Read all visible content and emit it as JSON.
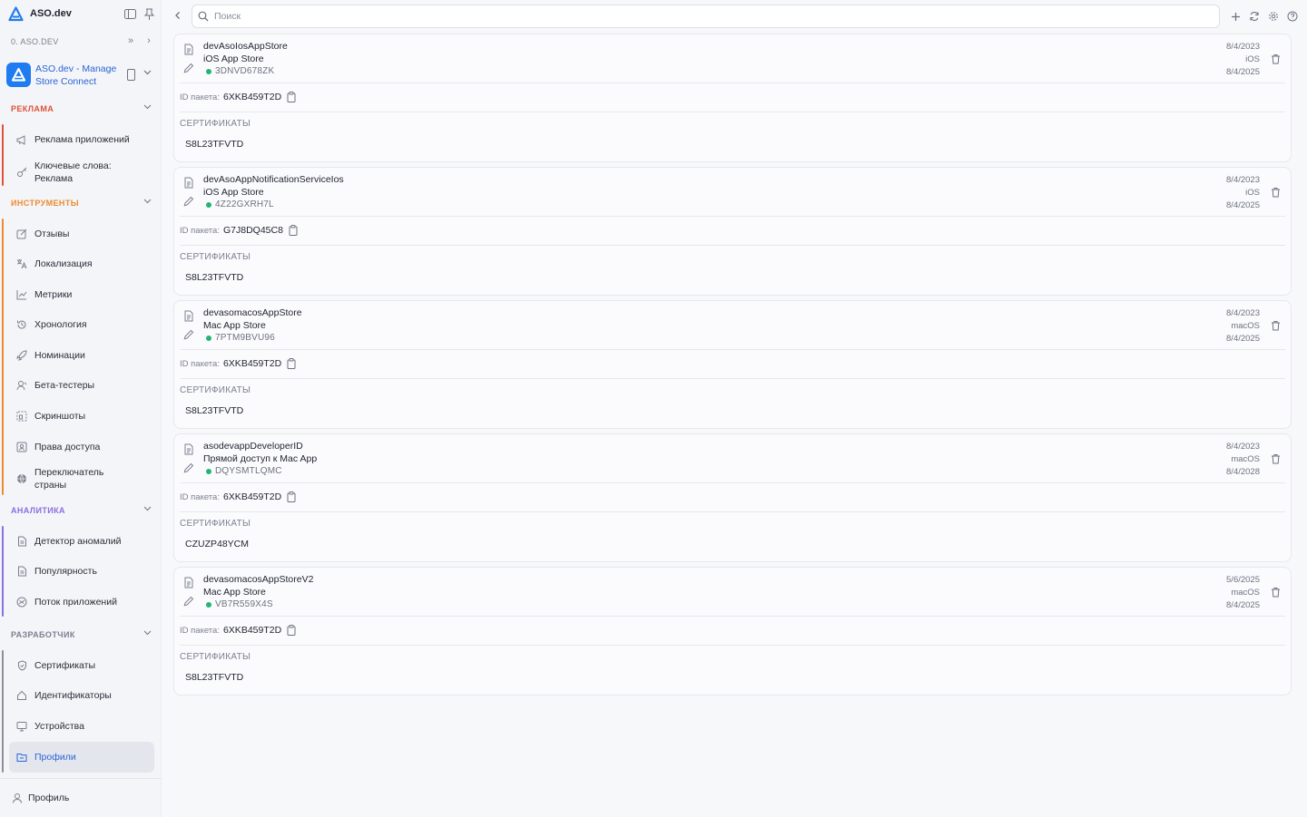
{
  "app": {
    "title": "ASO.dev",
    "org_label": "0. ASO.DEV",
    "app_name": "ASO.dev - Manage Store Connect"
  },
  "search": {
    "placeholder": "Поиск"
  },
  "colors": {
    "reklama": "#e0503a",
    "instruments": "#ee8a2e",
    "analytics": "#8a6fe0",
    "developer": "#7b8090",
    "accent": "#2a64d6",
    "status_active": "#22b573"
  },
  "sidebar": {
    "sections": [
      {
        "label": "РЕКЛАМА",
        "items": [
          {
            "label": "Реклама приложений",
            "icon": "megaphone-icon"
          },
          {
            "label": "Ключевые слова: Реклама",
            "icon": "key-icon"
          }
        ]
      },
      {
        "label": "ИНСТРУМЕНТЫ",
        "items": [
          {
            "label": "Отзывы",
            "icon": "review-icon"
          },
          {
            "label": "Локализация",
            "icon": "translate-icon"
          },
          {
            "label": "Метрики",
            "icon": "chart-icon"
          },
          {
            "label": "Хронология",
            "icon": "history-icon"
          },
          {
            "label": "Номинации",
            "icon": "rocket-icon"
          },
          {
            "label": "Бета-тестеры",
            "icon": "tester-icon"
          },
          {
            "label": "Скриншоты",
            "icon": "screenshot-icon"
          },
          {
            "label": "Права доступа",
            "icon": "access-icon"
          },
          {
            "label": "Переключатель страны",
            "icon": "globe-icon"
          }
        ]
      },
      {
        "label": "АНАЛИТИКА",
        "items": [
          {
            "label": "Детектор аномалий",
            "icon": "document-icon"
          },
          {
            "label": "Популярность",
            "icon": "document-icon"
          },
          {
            "label": "Поток приложений",
            "icon": "flow-icon"
          }
        ]
      },
      {
        "label": "РАЗРАБОТЧИК",
        "items": [
          {
            "label": "Сертификаты",
            "icon": "shield-icon"
          },
          {
            "label": "Идентификаторы",
            "icon": "home-icon"
          },
          {
            "label": "Устройства",
            "icon": "monitor-icon"
          },
          {
            "label": "Профили",
            "icon": "folder-icon"
          }
        ]
      }
    ],
    "profile_label": "Профиль"
  },
  "cards": [
    {
      "name": "devAsoIosAppStore",
      "store": "iOS App Store",
      "profile_id": "3DNVD678ZK",
      "created": "8/4/2023",
      "platform": "iOS",
      "expires": "8/4/2025",
      "bundle_label": "ID пакета:",
      "bundle_id": "6XKB459T2D",
      "certs_label": "СЕРТИФИКАТЫ",
      "cert": "S8L23TFVTD"
    },
    {
      "name": "devAsoAppNotificationServiceIos",
      "store": "iOS App Store",
      "profile_id": "4Z22GXRH7L",
      "created": "8/4/2023",
      "platform": "iOS",
      "expires": "8/4/2025",
      "bundle_label": "ID пакета:",
      "bundle_id": "G7J8DQ45C8",
      "certs_label": "СЕРТИФИКАТЫ",
      "cert": "S8L23TFVTD"
    },
    {
      "name": "devasomacosAppStore",
      "store": "Mac App Store",
      "profile_id": "7PTM9BVU96",
      "created": "8/4/2023",
      "platform": "macOS",
      "expires": "8/4/2025",
      "bundle_label": "ID пакета:",
      "bundle_id": "6XKB459T2D",
      "certs_label": "СЕРТИФИКАТЫ",
      "cert": "S8L23TFVTD"
    },
    {
      "name": "asodevappDeveloperID",
      "store": "Прямой доступ к Mac App",
      "profile_id": "DQYSMTLQMC",
      "created": "8/4/2023",
      "platform": "macOS",
      "expires": "8/4/2028",
      "bundle_label": "ID пакета:",
      "bundle_id": "6XKB459T2D",
      "certs_label": "СЕРТИФИКАТЫ",
      "cert": "CZUZP48YCM"
    },
    {
      "name": "devasomacosAppStoreV2",
      "store": "Mac App Store",
      "profile_id": "VB7R559X4S",
      "created": "5/6/2025",
      "platform": "macOS",
      "expires": "8/4/2025",
      "bundle_label": "ID пакета:",
      "bundle_id": "6XKB459T2D",
      "certs_label": "СЕРТИФИКАТЫ",
      "cert": "S8L23TFVTD"
    }
  ]
}
